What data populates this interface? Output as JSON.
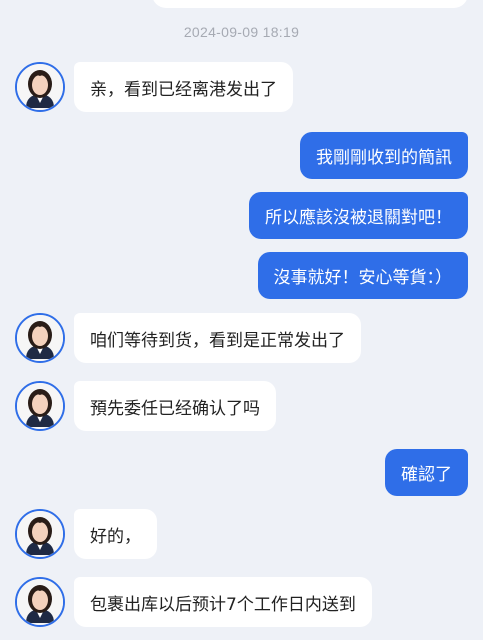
{
  "timestamp": "2024-09-09 18:19",
  "messages": [
    {
      "side": "in",
      "text": "亲，看到已经离港发出了"
    },
    {
      "side": "out",
      "text": "我剛剛收到的簡訊"
    },
    {
      "side": "out",
      "text": "所以應該沒被退關對吧！"
    },
    {
      "side": "out",
      "text": "沒事就好！安心等貨：）"
    },
    {
      "side": "in",
      "text": "咱们等待到货，看到是正常发出了"
    },
    {
      "side": "in",
      "text": "預先委任已经确认了吗"
    },
    {
      "side": "out",
      "text": "確認了"
    },
    {
      "side": "in",
      "text": "好的，"
    },
    {
      "side": "in",
      "text": "包裹出库以后预计7个工作日内送到"
    }
  ],
  "colors": {
    "background": "#eef1f7",
    "outgoing": "#2f6ee8",
    "incoming": "#ffffff"
  }
}
